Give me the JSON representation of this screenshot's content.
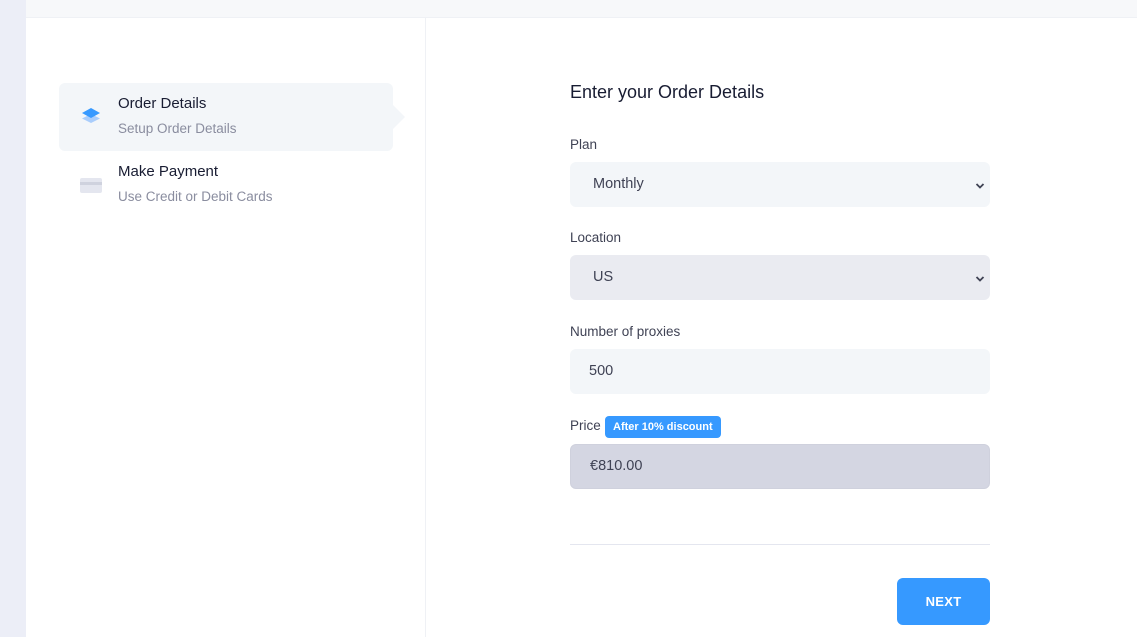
{
  "steps": [
    {
      "title": "Order Details",
      "desc": "Setup Order Details",
      "icon": "layers-icon",
      "active": true
    },
    {
      "title": "Make Payment",
      "desc": "Use Credit or Debit Cards",
      "icon": "credit-card-icon",
      "active": false
    }
  ],
  "form": {
    "title": "Enter your Order Details",
    "plan": {
      "label": "Plan",
      "value": "Monthly"
    },
    "location": {
      "label": "Location",
      "value": "US"
    },
    "proxies": {
      "label": "Number of proxies",
      "value": "500"
    },
    "price": {
      "label": "Price",
      "badge": "After 10% discount",
      "value": "€810.00"
    },
    "next_label": "NEXT"
  },
  "colors": {
    "accent": "#3699ff",
    "step_active_bg": "#f3f6f9",
    "readonly_bg": "#d4d6e2"
  }
}
